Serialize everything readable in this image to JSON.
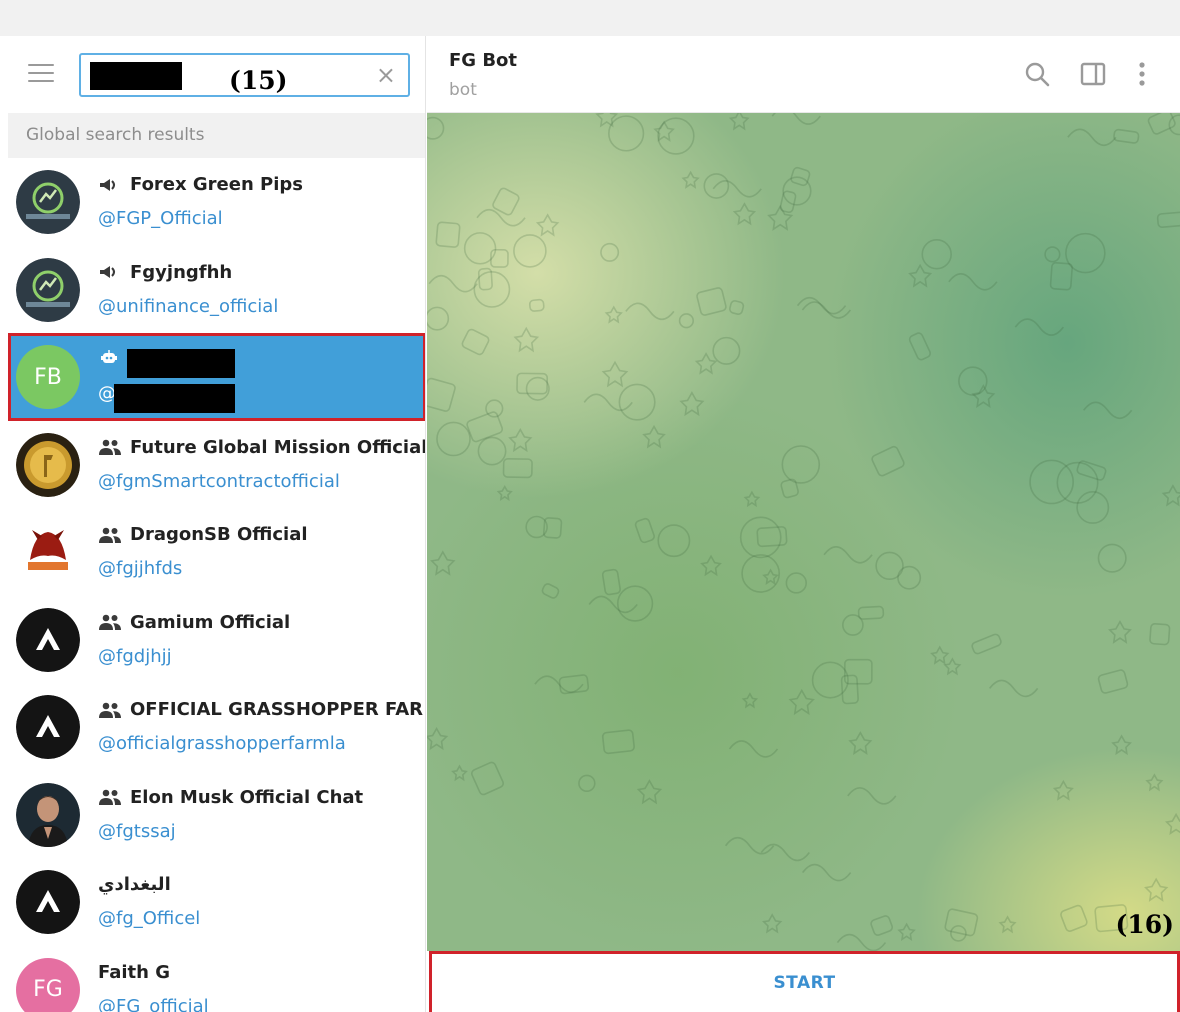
{
  "annotations": {
    "left": "(15)",
    "right": "(16)"
  },
  "search": {
    "clear_glyph": "×"
  },
  "left_panel": {
    "section_label": "Global search results",
    "results": [
      {
        "kind": "channel",
        "title": "Forex Green Pips",
        "handle": "@FGP_Official",
        "avatar_style": "dark-logo"
      },
      {
        "kind": "channel",
        "title": "Fgyjngfhh",
        "handle": "@unifinance_official",
        "avatar_style": "dark-logo"
      },
      {
        "kind": "bot",
        "initials": "FB",
        "handle_prefix": "@",
        "avatar_color": "#7bc862",
        "selected": true
      },
      {
        "kind": "group",
        "title": "Future Global Mission Official",
        "handle": "@fgmSmartcontractofficial",
        "avatar_style": "gold-logo"
      },
      {
        "kind": "group",
        "title": "DragonSB Official",
        "handle": "@fgjjhfds",
        "avatar_style": "red-logo"
      },
      {
        "kind": "group",
        "title": "Gamium Official",
        "handle": "@fgdjhjj",
        "avatar_style": "black-logo"
      },
      {
        "kind": "group",
        "title": "OFFICIAL GRASSHOPPER FAR...",
        "handle": "@officialgrasshopperfarmla",
        "avatar_style": "black-logo"
      },
      {
        "kind": "group",
        "title": "Elon Musk Official Chat",
        "handle": "@fgtssaj",
        "avatar_style": "photo"
      },
      {
        "kind": "user",
        "title": "البغدادي",
        "handle": "@fg_Officel",
        "avatar_style": "black-logo"
      },
      {
        "kind": "user",
        "title": "Faith G",
        "handle": "@FG_official",
        "initials": "FG",
        "avatar_color": "#e56fa1"
      }
    ]
  },
  "chat": {
    "title": "FG Bot",
    "subtitle": "bot",
    "start_label": "START"
  },
  "colors": {
    "accent": "#419fd9",
    "link": "#3a8fd0",
    "highlight_border": "#d0222a"
  },
  "icons": {
    "menu": "hamburger-menu-icon",
    "clear": "close-icon",
    "search": "search-icon",
    "sidebar": "sidebar-toggle-icon",
    "more": "more-vertical-icon",
    "channel": "megaphone-icon",
    "group": "group-people-icon",
    "bot": "bot-icon"
  }
}
